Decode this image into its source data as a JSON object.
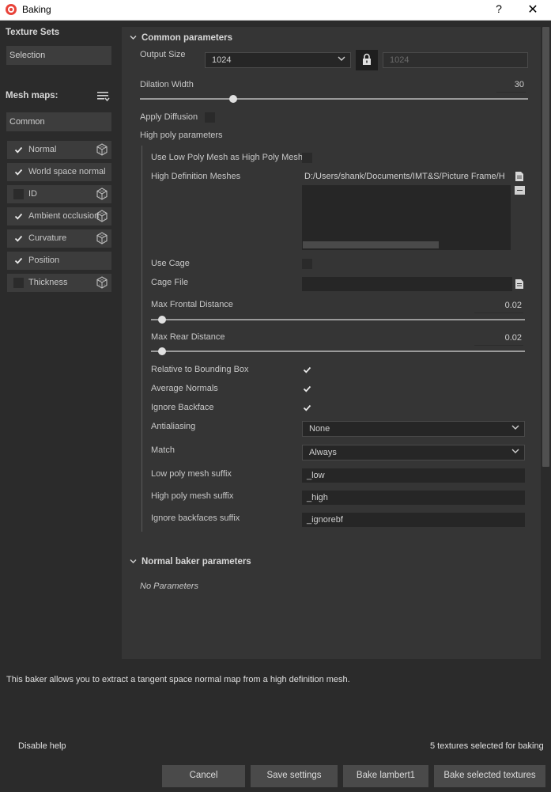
{
  "window": {
    "title": "Baking",
    "help_label": "?",
    "close_label": "✕"
  },
  "sidebar": {
    "texture_sets_title": "Texture Sets",
    "texture_sets_value": "Selection",
    "mesh_maps_title": "Mesh maps:",
    "mesh_maps_filter": "Common",
    "items": [
      {
        "label": "Normal",
        "checked": true
      },
      {
        "label": "World space normal",
        "checked": true
      },
      {
        "label": "ID",
        "checked": false
      },
      {
        "label": "Ambient occlusion",
        "checked": true
      },
      {
        "label": "Curvature",
        "checked": true
      },
      {
        "label": "Position",
        "checked": true
      },
      {
        "label": "Thickness",
        "checked": false
      }
    ]
  },
  "common": {
    "header": "Common parameters",
    "output_size_label": "Output Size",
    "output_size_value": "1024",
    "output_size_linked": "1024",
    "dilation_label": "Dilation Width",
    "dilation_value": "30",
    "apply_diffusion_label": "Apply Diffusion",
    "apply_diffusion_checked": false,
    "high_poly_label": "High poly parameters",
    "use_low_poly_label": "Use Low Poly Mesh as High Poly Mesh",
    "use_low_poly_checked": false,
    "hd_meshes_label": "High Definition Meshes",
    "hd_meshes_value": "D:/Users/shank/Documents/IMT&S/Picture Frame/H",
    "use_cage_label": "Use Cage",
    "use_cage_checked": false,
    "cage_file_label": "Cage File",
    "cage_file_value": "",
    "max_frontal_label": "Max Frontal Distance",
    "max_frontal_value": "0.02",
    "max_rear_label": "Max Rear Distance",
    "max_rear_value": "0.02",
    "relative_bbox_label": "Relative to Bounding Box",
    "relative_bbox_checked": true,
    "average_normals_label": "Average Normals",
    "average_normals_checked": true,
    "ignore_backface_label": "Ignore Backface",
    "ignore_backface_checked": true,
    "antialiasing_label": "Antialiasing",
    "antialiasing_value": "None",
    "match_label": "Match",
    "match_value": "Always",
    "low_suffix_label": "Low poly mesh suffix",
    "low_suffix_value": "_low",
    "high_suffix_label": "High poly mesh suffix",
    "high_suffix_value": "_high",
    "ignore_suffix_label": "Ignore backfaces suffix",
    "ignore_suffix_value": "_ignorebf"
  },
  "normal_baker": {
    "header": "Normal baker parameters",
    "note": "No Parameters"
  },
  "help_text": "This baker allows you to extract a tangent space normal map from a high definition mesh.",
  "footer": {
    "disable_help": "Disable help",
    "status": "5 textures selected for baking",
    "cancel": "Cancel",
    "save_settings": "Save settings",
    "bake_lambert": "Bake lambert1",
    "bake_selected": "Bake selected textures"
  },
  "sliders": {
    "dilation_fraction": 0.24,
    "max_frontal_fraction": 0.03,
    "max_rear_fraction": 0.03
  },
  "colors": {
    "panel_bg": "#353535",
    "window_bg": "#2b2b2b",
    "field_bg": "#262626",
    "button_bg": "#4a4a4a"
  }
}
